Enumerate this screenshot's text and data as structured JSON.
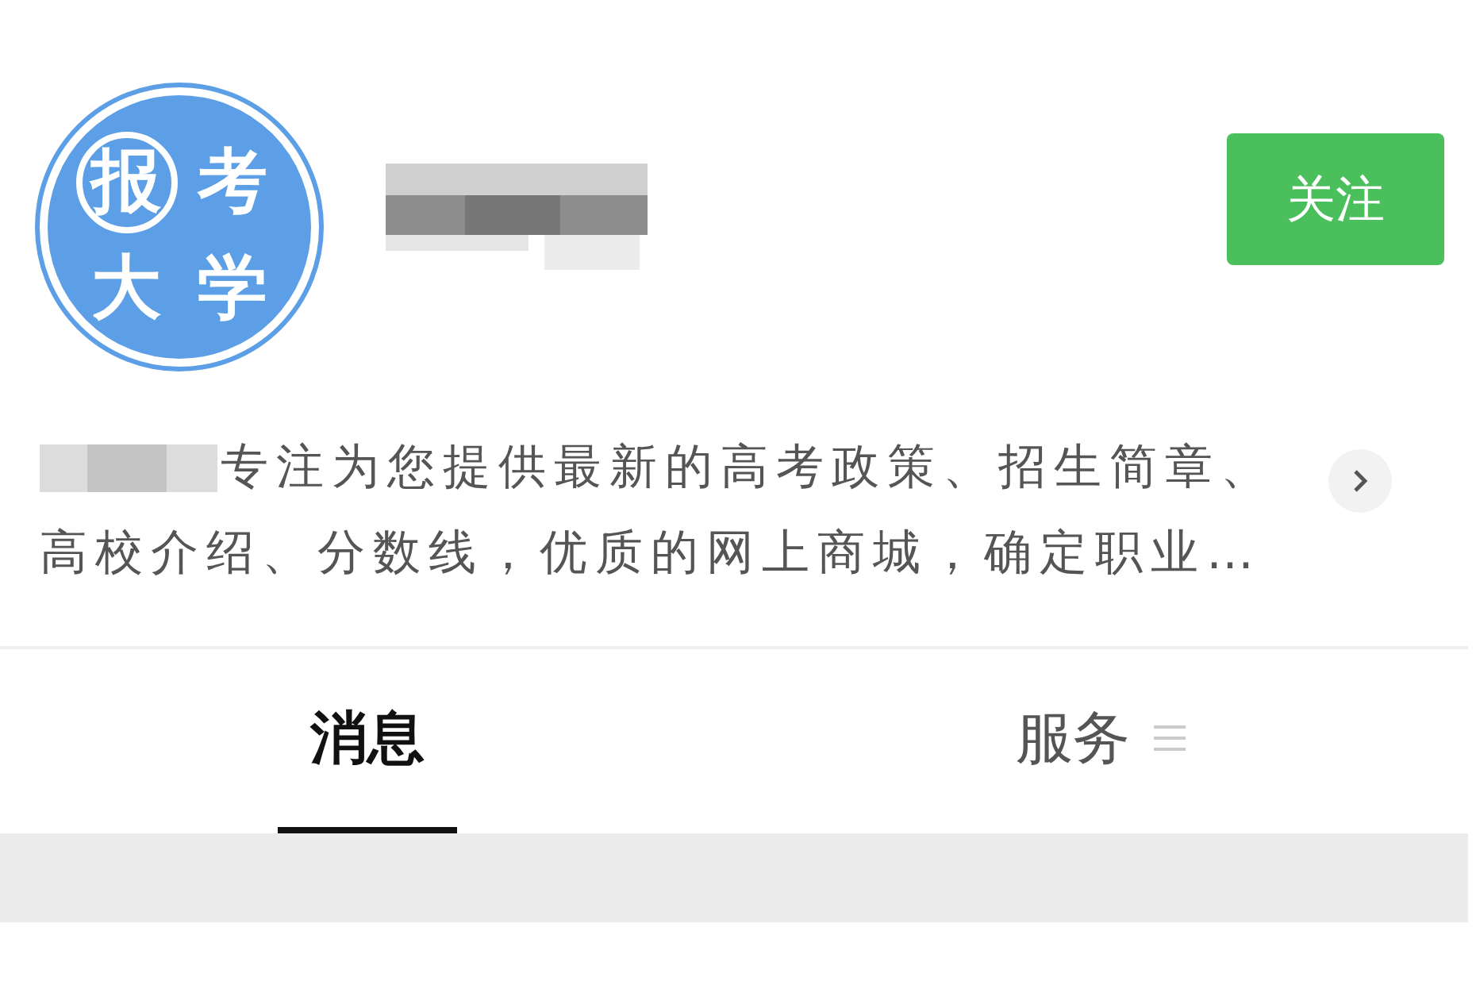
{
  "account": {
    "logo_chars": [
      "报",
      "考",
      "大",
      "学"
    ]
  },
  "follow_button": "关注",
  "description": "专注为您提供最新的高考政策、招生简章、高校介绍、分数线，优质的网上商城，确定职业…",
  "tabs": [
    {
      "label": "消息",
      "selected": true,
      "kind": "plain"
    },
    {
      "label": "服务",
      "selected": false,
      "kind": "menu"
    }
  ]
}
